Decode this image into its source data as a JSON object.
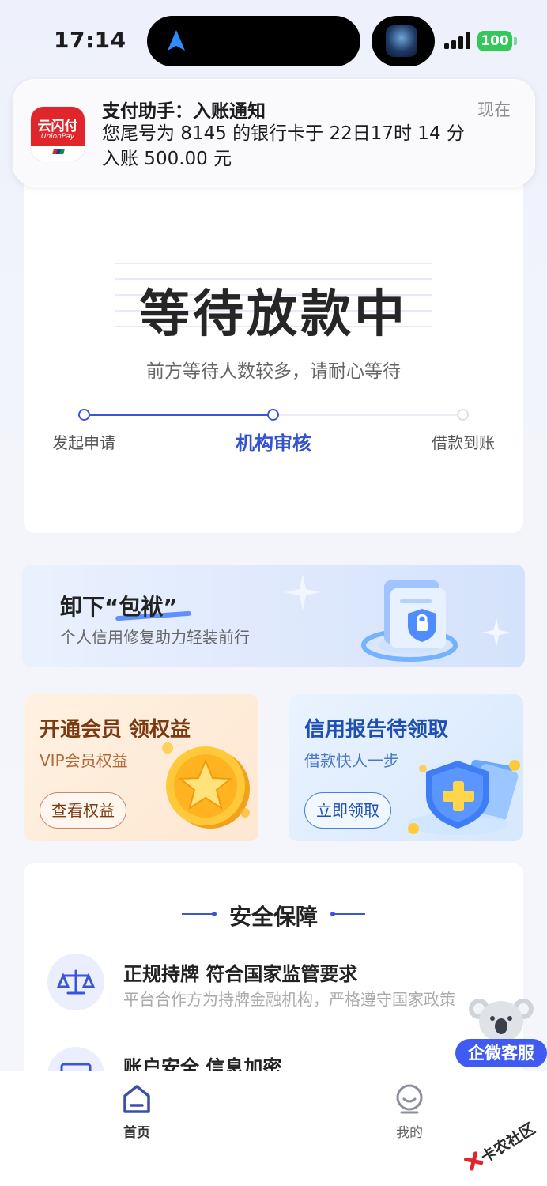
{
  "status_bar": {
    "time": "17:14",
    "battery": "100"
  },
  "notification": {
    "app_icon_text": "云闪付",
    "app_icon_subtext": "UnionPay",
    "title": "支付助手：入账通知",
    "time": "现在",
    "body_line1": "您尾号为 8145 的银行卡于 22日17时 14 分",
    "body_line2": "入账 500.00 元"
  },
  "status_card": {
    "title": "等待放款中",
    "subtitle": "前方等待人数较多，请耐心等待",
    "progress_fraction": 0.5,
    "steps": [
      {
        "label": "发起申请",
        "state": "done"
      },
      {
        "label": "机构审核",
        "state": "active"
      },
      {
        "label": "借款到账",
        "state": "pending"
      }
    ]
  },
  "banner": {
    "title": "卸下“包袱”",
    "subtitle": "个人信用修复助力轻装前行",
    "illustration": "lock-folder-icon"
  },
  "promo_cards": [
    {
      "title": "开通会员 领权益",
      "subtitle": "VIP会员权益",
      "button": "查看权益",
      "icon": "star-coin-icon"
    },
    {
      "title": "信用报告待领取",
      "subtitle": "借款快人一步",
      "button": "立即领取",
      "icon": "shield-plus-icon"
    }
  ],
  "security": {
    "title": "安全保障",
    "items": [
      {
        "title": "正规持牌 符合国家监管要求",
        "desc": "平台合作方为持牌金融机构，严格遵守国家政策",
        "icon": "scale-icon"
      },
      {
        "title": "账户安全 信息加密",
        "desc": "",
        "icon": "monitor-icon"
      }
    ]
  },
  "customer_service": {
    "label": "企微客服",
    "icon": "koala-avatar-icon"
  },
  "bottom_nav": {
    "items": [
      {
        "label": "首页",
        "icon": "home-icon",
        "active": true
      },
      {
        "label": "我的",
        "icon": "profile-icon",
        "active": false
      }
    ]
  },
  "watermark": {
    "text": "卡农社区"
  },
  "colors": {
    "accent": "#3a56d6",
    "notification_red": "#e0262b",
    "battery_green": "#34c759",
    "cs_button": "#3f5bf1"
  }
}
